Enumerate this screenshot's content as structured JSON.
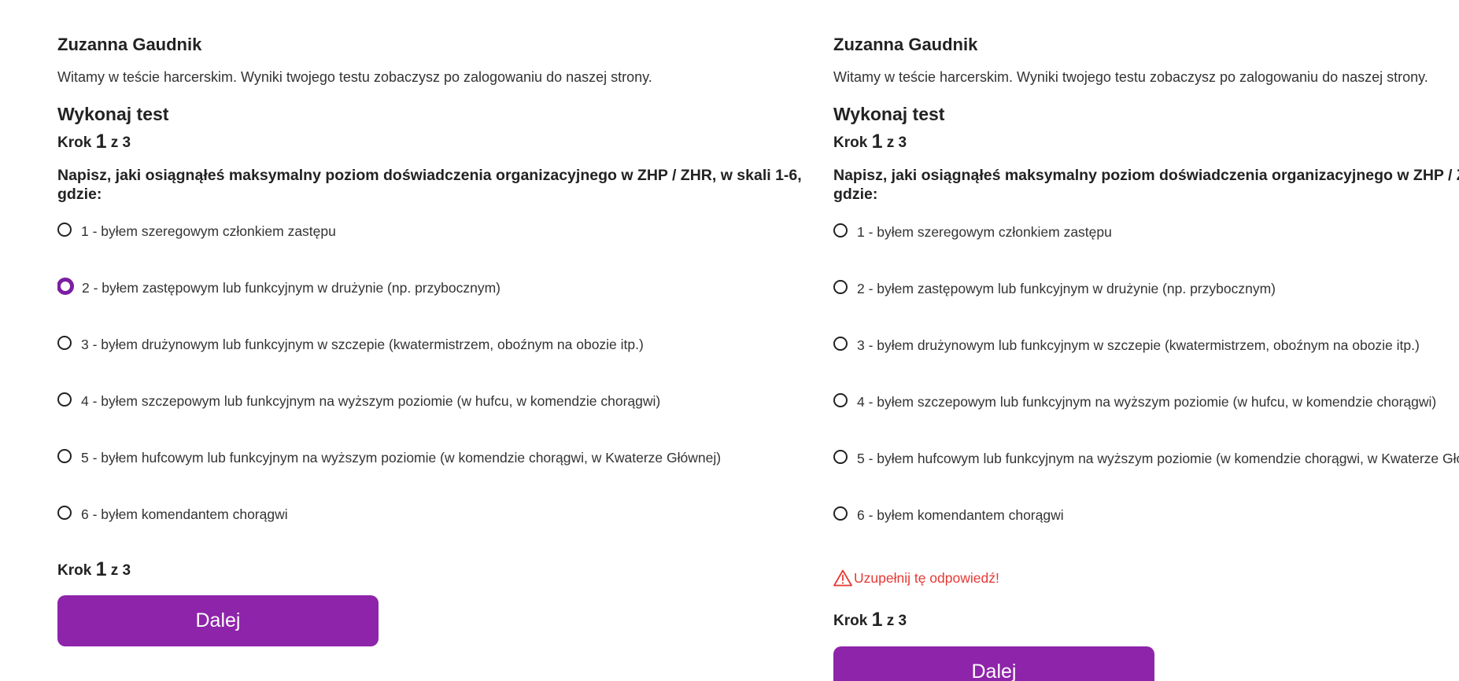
{
  "user_name": "Zuzanna Gaudnik",
  "welcome": "Witamy w teście harcerskim. Wyniki twojego testu zobaczysz po zalogowaniu do naszej strony.",
  "section_title": "Wykonaj test",
  "step": {
    "prefix": "Krok",
    "current": "1",
    "of": "z",
    "total": "3"
  },
  "question": "Napisz, jaki osiągnąłeś maksymalny poziom doświadczenia organizacyjnego w ZHP / ZHR, w skali 1-6, gdzie:",
  "options": [
    "1 - byłem szeregowym członkiem zastępu",
    "2 - byłem zastępowym lub funkcyjnym w drużynie (np. przybocznym)",
    "3 - byłem drużynowym lub funkcyjnym w szczepie (kwatermistrzem, oboźnym na obozie itp.)",
    "4 - byłem szczepowym lub funkcyjnym na wyższym poziomie (w hufcu, w komendzie chorągwi)",
    "5 - byłem hufcowym lub funkcyjnym na wyższym poziomie (w komendzie chorągwi, w Kwaterze Głównej)",
    "6 - byłem komendantem chorągwi"
  ],
  "left_panel": {
    "selected_option": "2 - byłem zastępowym lub funkcyjnym w drużynie (np. przybocznym)"
  },
  "right_panel": {
    "selected_option": null,
    "error_message": "Uzupełnij tę odpowiedź!"
  },
  "next_button_label": "Dalej",
  "colors": {
    "accent": "#8e24aa",
    "radio_selected": "#7b1fa2",
    "error": "#e53935"
  },
  "icons": {
    "warning": "warning-triangle-icon"
  }
}
